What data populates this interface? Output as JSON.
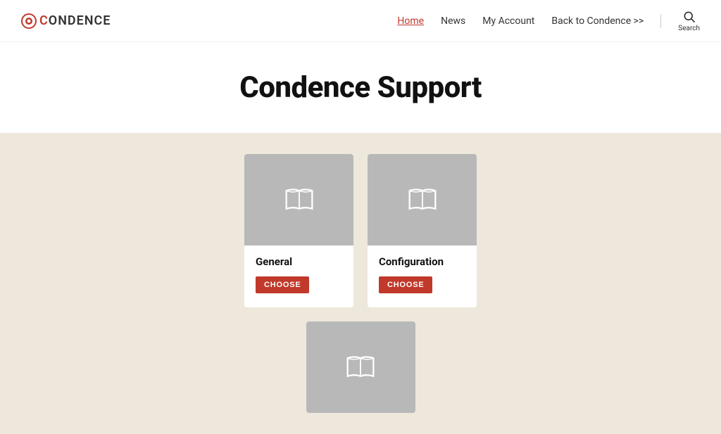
{
  "header": {
    "logo_text": "ONDENCE",
    "logo_letter": "C",
    "nav": {
      "home_label": "Home",
      "news_label": "News",
      "myaccount_label": "My Account",
      "back_label": "Back to Condence >>",
      "search_label": "Search"
    }
  },
  "page": {
    "title": "Condence Support"
  },
  "cards": [
    {
      "title": "General",
      "button_label": "CHOOSE"
    },
    {
      "title": "Configuration",
      "button_label": "CHOOSE"
    }
  ],
  "partial_card": {
    "visible": true
  },
  "colors": {
    "accent": "#c0392b",
    "bg_content": "#ede8db",
    "card_image_bg": "#b8b8b8"
  }
}
